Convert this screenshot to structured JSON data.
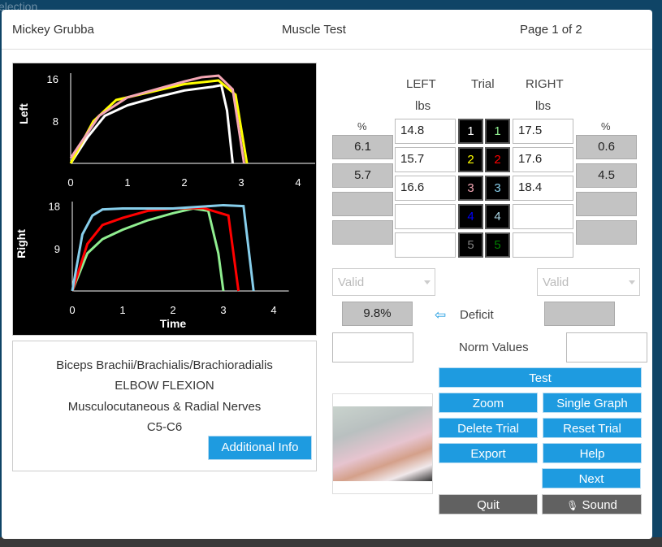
{
  "background_title": "election",
  "header": {
    "patient": "Mickey  Grubba",
    "title": "Muscle Test",
    "page": "Page 1 of 2"
  },
  "graphs": {
    "left": {
      "label": "Left",
      "yticks": [
        "16",
        "8"
      ],
      "xticks": [
        "0",
        "1",
        "2",
        "3",
        "4"
      ],
      "series": [
        {
          "color": "#ffffff",
          "points": [
            [
              0,
              0
            ],
            [
              0.3,
              5
            ],
            [
              0.6,
              9
            ],
            [
              1,
              11
            ],
            [
              1.5,
              12.5
            ],
            [
              2,
              13.8
            ],
            [
              2.5,
              14.5
            ],
            [
              2.65,
              14.8
            ],
            [
              2.75,
              10
            ],
            [
              2.85,
              0
            ]
          ]
        },
        {
          "color": "#ffff00",
          "points": [
            [
              0,
              0
            ],
            [
              0.4,
              8
            ],
            [
              0.8,
              12
            ],
            [
              1.2,
              13
            ],
            [
              2,
              15
            ],
            [
              2.6,
              15.7
            ],
            [
              2.9,
              13
            ],
            [
              3.1,
              0
            ]
          ]
        },
        {
          "color": "#f4a6b4",
          "points": [
            [
              0,
              1
            ],
            [
              0.5,
              9
            ],
            [
              1,
              12.5
            ],
            [
              1.5,
              14
            ],
            [
              2,
              15.5
            ],
            [
              2.3,
              16.3
            ],
            [
              2.6,
              16.6
            ],
            [
              2.85,
              14
            ],
            [
              3.05,
              0
            ]
          ]
        }
      ]
    },
    "right": {
      "label": "Right",
      "yticks": [
        "18",
        "9"
      ],
      "xticks": [
        "0",
        "1",
        "2",
        "3",
        "4"
      ],
      "xlabel": "Time",
      "series": [
        {
          "color": "#90ee90",
          "points": [
            [
              0,
              0
            ],
            [
              0.3,
              8
            ],
            [
              0.6,
              11
            ],
            [
              1,
              13
            ],
            [
              1.5,
              15
            ],
            [
              2,
              16.5
            ],
            [
              2.4,
              17.5
            ],
            [
              2.7,
              17
            ],
            [
              2.9,
              8
            ],
            [
              3.0,
              0
            ]
          ]
        },
        {
          "color": "#ff0000",
          "points": [
            [
              0,
              0
            ],
            [
              0.3,
              10
            ],
            [
              0.6,
              14
            ],
            [
              1,
              15.5
            ],
            [
              1.5,
              17
            ],
            [
              2,
              17.5
            ],
            [
              2.6,
              17.6
            ],
            [
              3.1,
              16
            ],
            [
              3.3,
              0
            ]
          ]
        },
        {
          "color": "#87ceeb",
          "points": [
            [
              0,
              0
            ],
            [
              0.2,
              12
            ],
            [
              0.4,
              16
            ],
            [
              0.6,
              17.3
            ],
            [
              1,
              17.5
            ],
            [
              2,
              17.5
            ],
            [
              3,
              18.2
            ],
            [
              3.4,
              18
            ],
            [
              3.6,
              0
            ]
          ]
        }
      ]
    }
  },
  "info": {
    "muscle": "Biceps Brachii/Brachialis/Brachioradialis",
    "motion": "ELBOW FLEXION",
    "nerves": "Musculocutaneous & Radial Nerves",
    "level": "C5-C6",
    "additional_info": "Additional Info"
  },
  "table": {
    "left_header": "LEFT",
    "trial_header": "Trial",
    "right_header": "RIGHT",
    "unit": "lbs",
    "pct": "%",
    "left_values": [
      "14.8",
      "15.7",
      "16.6",
      "",
      ""
    ],
    "right_values": [
      "17.5",
      "17.6",
      "18.4",
      "",
      ""
    ],
    "left_pct": [
      "6.1",
      "5.7",
      "",
      ""
    ],
    "right_pct": [
      "0.6",
      "4.5",
      "",
      ""
    ],
    "trials": [
      "1",
      "2",
      "3",
      "4",
      "5"
    ],
    "left_trial_colors": [
      "#ffffff",
      "#ffff00",
      "#f4a6b4",
      "#0000ff",
      "#808080"
    ],
    "right_trial_colors": [
      "#90ee90",
      "#ff0000",
      "#87ceeb",
      "#add8e6",
      "#008000"
    ]
  },
  "validity": {
    "left": "Valid",
    "right": "Valid"
  },
  "deficit": {
    "value": "9.8%",
    "label": "Deficit",
    "right": ""
  },
  "norm": {
    "label": "Norm Values",
    "left": "",
    "right": ""
  },
  "buttons": {
    "test": "Test",
    "zoom": "Zoom",
    "single_graph": "Single Graph",
    "delete_trial": "Delete Trial",
    "reset_trial": "Reset Trial",
    "export": "Export",
    "help": "Help",
    "next": "Next",
    "quit": "Quit",
    "sound": "Sound"
  }
}
